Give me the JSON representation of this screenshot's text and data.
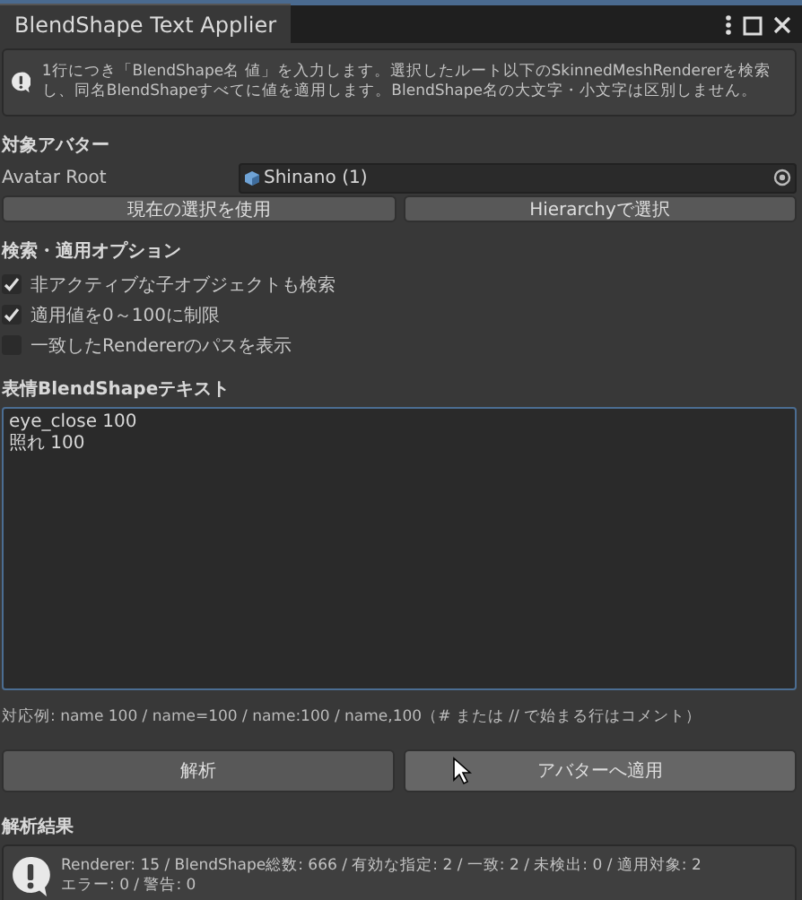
{
  "window": {
    "title": "BlendShape Text Applier"
  },
  "help": {
    "text": "1行につき「BlendShape名 値」を入力します。選択したルート以下のSkinnedMeshRendererを検索し、同名BlendShapeすべてに値を適用します。BlendShape名の大文字・小文字は区別しません。"
  },
  "avatar_section": {
    "header": "対象アバター",
    "field_label": "Avatar Root",
    "field_value": "Shinano (1)",
    "buttons": [
      "現在の選択を使用",
      "Hierarchyで選択"
    ]
  },
  "options_section": {
    "header": "検索・適用オプション",
    "options": [
      {
        "label": "非アクティブな子オブジェクトも検索",
        "checked": true
      },
      {
        "label": "適用値を0～100に制限",
        "checked": true
      },
      {
        "label": "一致したRendererのパスを表示",
        "checked": false
      }
    ]
  },
  "text_section": {
    "header": "表情BlendShapeテキスト",
    "value": "eye_close 100\n照れ 100",
    "hint": "対応例: name 100 / name=100 / name:100 / name,100（# または // で始まる行はコメント）"
  },
  "actions": [
    {
      "label": "解析",
      "hovered": false
    },
    {
      "label": "アバターへ適用",
      "hovered": true
    }
  ],
  "result_section": {
    "header": "解析結果",
    "lines": [
      "Renderer: 15 / BlendShape総数: 666 / 有効な指定: 2 / 一致: 2 / 未検出: 0 / 適用対象: 2",
      "エラー: 0 / 警告: 0"
    ]
  }
}
